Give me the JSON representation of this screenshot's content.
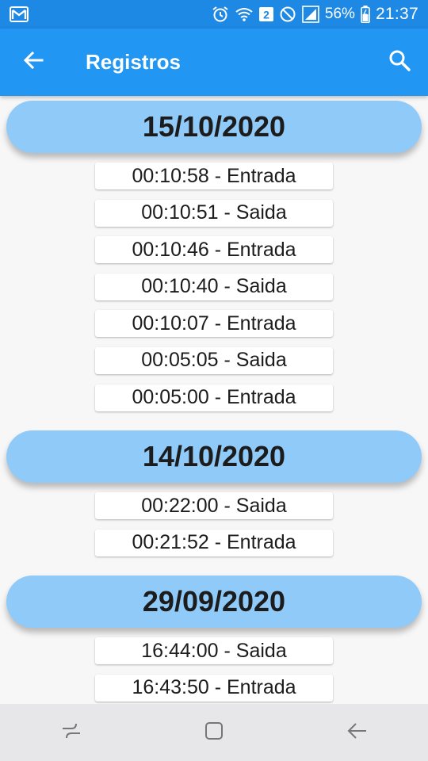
{
  "status_bar": {
    "battery_percent": "56%",
    "time": "21:37",
    "sim_badge": "2",
    "icons": [
      "gmail-icon",
      "alarm-icon",
      "wifi-icon",
      "sim-icon",
      "dnd-icon",
      "signal-icon",
      "battery-icon"
    ]
  },
  "app_bar": {
    "title": "Registros",
    "back_icon": "arrow-back-icon",
    "search_icon": "search-icon"
  },
  "groups": [
    {
      "date": "15/10/2020",
      "entries": [
        "00:10:58 - Entrada",
        "00:10:51 - Saida",
        "00:10:46 - Entrada",
        "00:10:40 - Saida",
        "00:10:07 - Entrada",
        "00:05:05 - Saida",
        "00:05:00 - Entrada"
      ]
    },
    {
      "date": "14/10/2020",
      "entries": [
        "00:22:00 - Saida",
        "00:21:52 - Entrada"
      ]
    },
    {
      "date": "29/09/2020",
      "entries": [
        "16:44:00 - Saida",
        "16:43:50 - Entrada"
      ]
    },
    {
      "date": "",
      "entries": []
    }
  ],
  "nav_bar": {
    "icons": [
      "recents-icon",
      "home-icon",
      "back-icon"
    ]
  },
  "colors": {
    "status_bar": "#1e88e5",
    "app_bar": "#2196f3",
    "date_header": "#90caf9",
    "background": "#f7f7f7",
    "nav_bar": "#e7e7e9"
  }
}
